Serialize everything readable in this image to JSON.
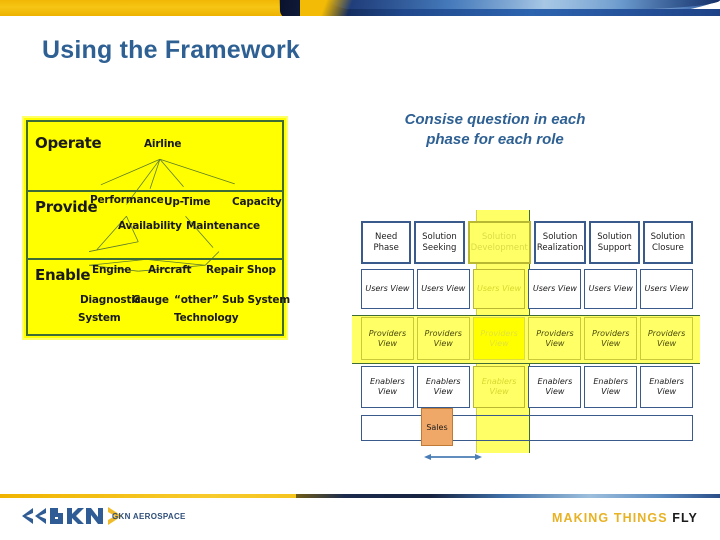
{
  "slide": {
    "title": "Using the Framework",
    "callout_line1": "Consise question in each",
    "callout_line2": "phase for each role",
    "title_color": "#2e6093",
    "accent_gold": "#f2b705",
    "accent_blue": "#3a5a8c",
    "highlight_yellow": "#ffff00"
  },
  "framework": {
    "levels": [
      {
        "name": "Operate"
      },
      {
        "name": "Provide"
      },
      {
        "name": "Enable"
      }
    ],
    "operate_nodes": [
      "Airline"
    ],
    "provide_nodes": [
      "Performance",
      "Up-Time",
      "Capacity",
      "Availability",
      "Maintenance"
    ],
    "enable_nodes": [
      "Engine",
      "Aircraft",
      "Repair Shop",
      "Diagnostic",
      "Gauge",
      "“other” Sub System",
      "System",
      "Technology"
    ],
    "nodes": {
      "airline": "Airline",
      "performance": "Performance",
      "uptime": "Up-Time",
      "capacity": "Capacity",
      "availability": "Availability",
      "maintenance": "Maintenance",
      "engine": "Engine",
      "aircraft": "Aircraft",
      "repair_shop": "Repair Shop",
      "diagnostic": "Diagnostic",
      "gauge": "Gauge",
      "other_sub_system": "“other” Sub System",
      "system": "System",
      "technology": "Technology"
    }
  },
  "grid": {
    "phases": [
      "Need Phase",
      "Solution Seeking",
      "Solution Development",
      "Solution Realization",
      "Solution Support",
      "Solution Closure"
    ],
    "rows": [
      {
        "role": "Users View",
        "cells": [
          "Users View",
          "Users View",
          "Users View",
          "Users View",
          "Users View",
          "Users View"
        ]
      },
      {
        "role": "Providers View",
        "cells": [
          "Providers View",
          "Providers View",
          "Providers View",
          "Providers View",
          "Providers View",
          "Providers View"
        ]
      },
      {
        "role": "Enablers View",
        "cells": [
          "Enablers View",
          "Enablers View",
          "Enablers View",
          "Enablers View",
          "Enablers View",
          "Enablers View"
        ]
      }
    ],
    "sales_label": "Sales",
    "highlighted_column_index": 2,
    "highlighted_row": "Providers View"
  },
  "footer": {
    "brand": "GKN AEROSPACE",
    "tagline_gold": "MAKING THINGS",
    "tagline_dark": "FLY"
  }
}
